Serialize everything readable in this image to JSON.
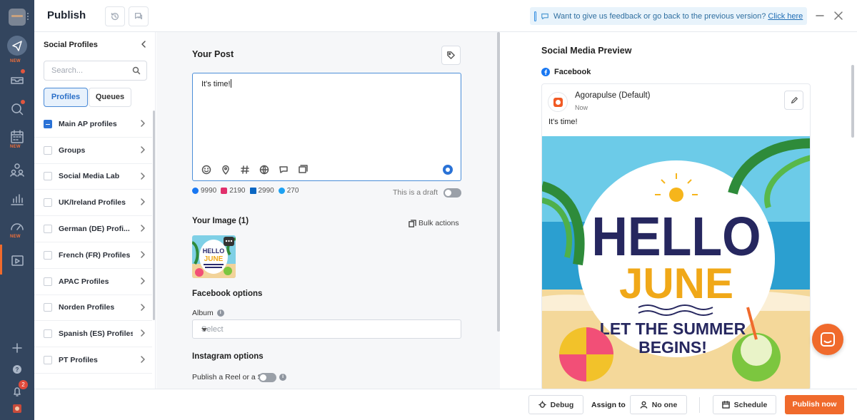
{
  "app": {
    "title": "Publish"
  },
  "nav": {
    "new_labels": [
      "NEW",
      "NEW",
      "NEW"
    ],
    "notifications_badge": "2"
  },
  "feedback": {
    "text": "Want to give us feedback or go back to the previous version?",
    "link": "Click here"
  },
  "profiles": {
    "title": "Social Profiles",
    "search_placeholder": "Search...",
    "tabs": [
      "Profiles",
      "Queues"
    ],
    "items": [
      {
        "label": "Main AP profiles",
        "checked": true
      },
      {
        "label": "Groups",
        "checked": false
      },
      {
        "label": "Social Media Lab",
        "checked": false
      },
      {
        "label": "UK/Ireland Profiles",
        "checked": false
      },
      {
        "label": "German (DE) Profi...",
        "checked": false
      },
      {
        "label": "French (FR) Profiles",
        "checked": false
      },
      {
        "label": "APAC Profiles",
        "checked": false
      },
      {
        "label": "Norden Profiles",
        "checked": false
      },
      {
        "label": "Spanish (ES) Profiles",
        "checked": false
      },
      {
        "label": "PT Profiles",
        "checked": false
      }
    ]
  },
  "composer": {
    "your_post": "Your Post",
    "post_text": "It's time!",
    "counts": {
      "facebook": "9990",
      "instagram": "2190",
      "linkedin": "2990",
      "twitter": "270"
    },
    "draft_label": "This is a draft",
    "your_image": "Your Image (1)",
    "bulk_actions": "Bulk actions",
    "facebook_options": "Facebook options",
    "album_label": "Album",
    "album_placeholder": "Select",
    "instagram_options": "Instagram options",
    "reel_label": "Publish a Reel or a Story"
  },
  "preview": {
    "title": "Social Media Preview",
    "network": "Facebook",
    "account": "Agorapulse (Default)",
    "time": "Now",
    "post_text": "It's time!",
    "image_text": {
      "line1": "HELLO",
      "line2": "JUNE",
      "line3": "LET THE SUMMER",
      "line4": "BEGINS!"
    }
  },
  "colors": {
    "accent": "#f06a2c",
    "primary_blue": "#2a72d6",
    "nav_bg": "#33455e"
  },
  "bottom": {
    "debug": "Debug",
    "assign_to": "Assign to",
    "assignee": "No one",
    "schedule": "Schedule",
    "publish_now": "Publish now"
  }
}
